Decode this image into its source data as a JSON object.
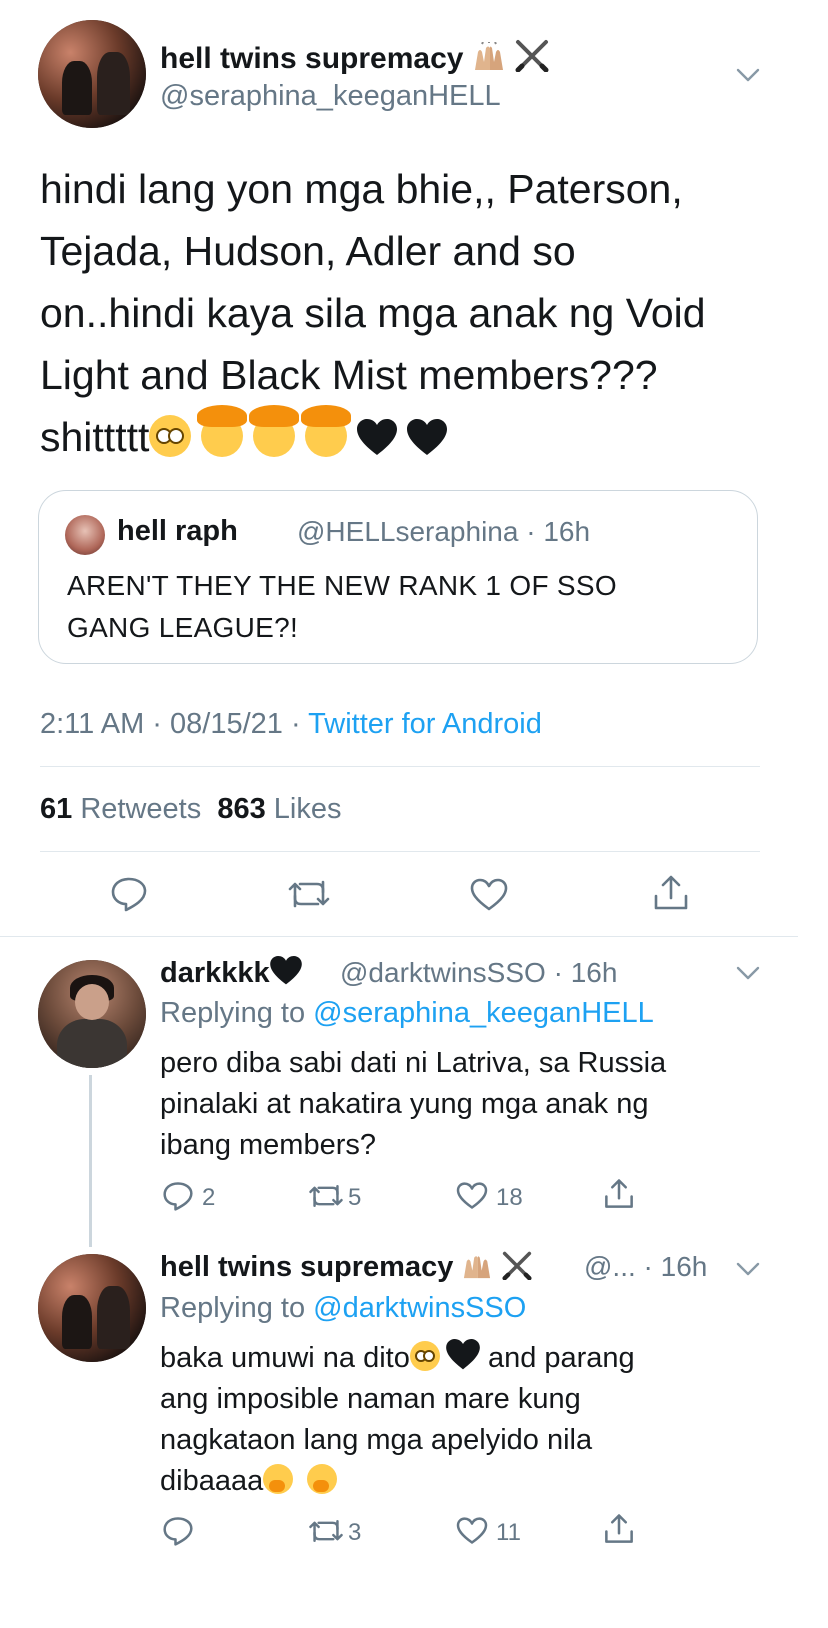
{
  "tweet": {
    "author_name": "hell twins supremacy",
    "author_handle": "@seraphina_keeganHELL",
    "text_lines": [
      "hindi lang yon mga bhie,, Paterson,",
      "Tejada, Hudson, Adler and so",
      "on..hindi kaya sila mga anak ng Void",
      "Light and Black Mist members???",
      "shittttt"
    ],
    "quoted": {
      "name": "hell raph",
      "handle": "@HELLseraphina",
      "time": "· 16h",
      "text_lines": [
        "AREN'T THEY THE NEW RANK 1 OF SSO",
        "GANG LEAGUE?!"
      ]
    },
    "time": "2:11 AM · 08/15/21 · ",
    "source": "Twitter for Android",
    "retweets": "61",
    "retweets_label": "Retweets",
    "likes": "863",
    "likes_label": "Likes"
  },
  "replies": [
    {
      "name": "darkkkk",
      "handle": "@darktwinsSSO",
      "time": "· 16h",
      "replying_to_label": "Replying to ",
      "replying_to": "@seraphina_keeganHELL",
      "text_lines": [
        "pero diba sabi dati ni Latriva, sa Russia",
        "pinalaki at nakatira yung mga anak ng",
        "ibang members?"
      ],
      "replies": "2",
      "retweets": "5",
      "likes": "18"
    },
    {
      "name": "hell twins supremacy",
      "handle": "@...",
      "time": "· 16h",
      "replying_to_label": "Replying to ",
      "replying_to": "@darktwinsSSO",
      "text_lines": [
        "baka umuwi na dito",
        "and parang",
        "ang imposible naman mare kung",
        "nagkataon lang mga apelyido nila",
        "dibaaaa"
      ],
      "retweets": "3",
      "likes": "11"
    }
  ],
  "icons": {
    "reply": "reply-icon",
    "retweet": "retweet-icon",
    "like": "heart-icon",
    "share": "share-icon",
    "more": "chevron-down-icon"
  },
  "colors": {
    "accent": "#1da1f2",
    "secondary_text": "#657786",
    "divider": "#e1e8ed"
  }
}
